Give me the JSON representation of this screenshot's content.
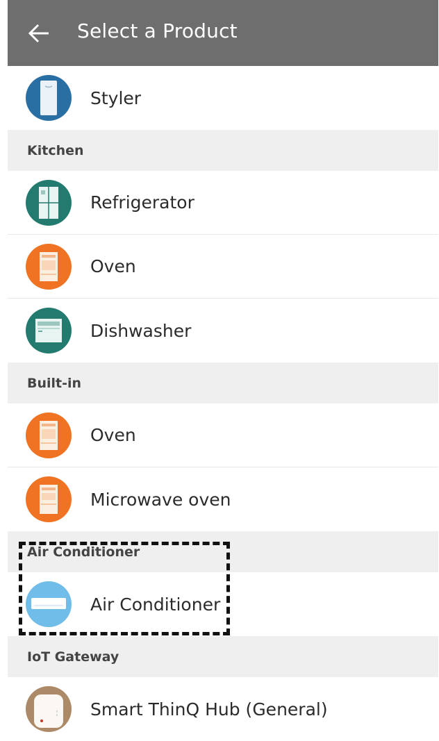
{
  "header": {
    "title": "Select a Product"
  },
  "colors": {
    "header_bg": "#6e6e6e",
    "styler": "#2a6fa4",
    "teal": "#237a6e",
    "orange": "#f07223",
    "sky": "#6fbde8",
    "hub": "#ad8a67"
  },
  "list": {
    "top_item": {
      "label": "Styler",
      "icon": "styler-icon"
    },
    "sections": [
      {
        "title": "Kitchen",
        "items": [
          {
            "label": "Refrigerator",
            "icon": "refrigerator-icon"
          },
          {
            "label": "Oven",
            "icon": "oven-icon"
          },
          {
            "label": "Dishwasher",
            "icon": "dishwasher-icon"
          }
        ]
      },
      {
        "title": "Built-in",
        "items": [
          {
            "label": "Oven",
            "icon": "oven-icon"
          },
          {
            "label": "Microwave oven",
            "icon": "microwave-icon"
          }
        ]
      },
      {
        "title": "Air Conditioner",
        "items": [
          {
            "label": "Air Conditioner",
            "icon": "air-conditioner-icon"
          }
        ]
      },
      {
        "title": "IoT Gateway",
        "items": [
          {
            "label": "Smart ThinQ Hub (General)",
            "icon": "hub-icon"
          }
        ]
      }
    ]
  }
}
